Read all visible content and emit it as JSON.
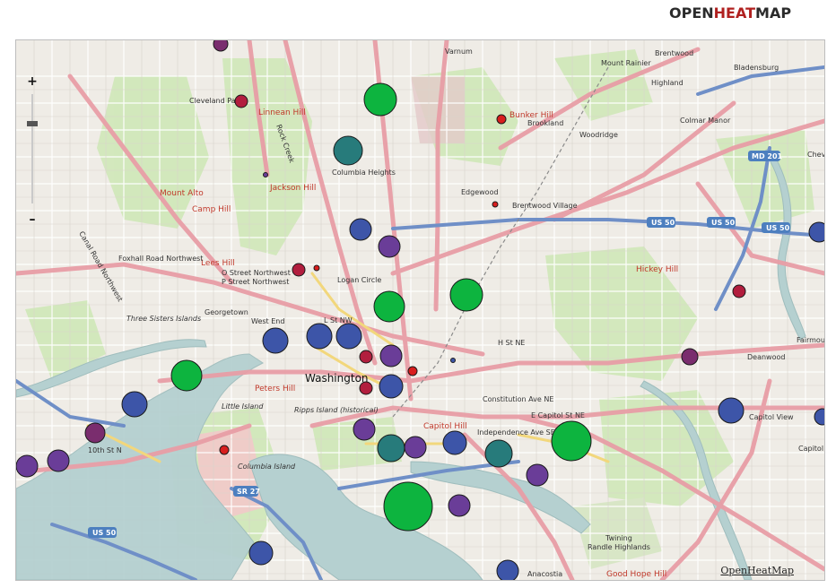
{
  "brand": {
    "part1": "OPEN",
    "part2": "HEAT",
    "part3": "MAP"
  },
  "zoom": {
    "plus": "+",
    "minus": "–"
  },
  "credit": "OpenHeatMap",
  "colors": {
    "green": "#0db43f",
    "teal": "#277b7b",
    "blue": "#3d55a8",
    "purple": "#6a3d98",
    "plum": "#7a2d6e",
    "crimson": "#b21e3e",
    "red": "#d81e1e"
  },
  "labels": [
    "Varnum",
    "Mount Rainier",
    "Brentwood",
    "Highland",
    "Bladensburg",
    "Cleveland Park",
    "Linnean Hill",
    "Bunker Hill",
    "Brookland",
    "Colmar Manor",
    "Columbia Heights",
    "Woodridge",
    "Mount Alto",
    "Jackson Hill",
    "Edgewood",
    "Brentwood Village",
    "Camp Hill",
    "Lees Hill",
    "Foxhall Road Northwest",
    "O Street Northwest",
    "P Street Northwest",
    "Logan Circle",
    "Hickey Hill",
    "Georgetown",
    "Three Sisters Islands",
    "West End",
    "L St NW",
    "Washington",
    "Peters Hill",
    "Little Island",
    "Ripps Island (historical)",
    "Capitol Hill",
    "Columbia Island",
    "Independence Ave SE",
    "Constitution Ave NE",
    "E Capitol St NE",
    "H St NE",
    "Deanwood",
    "Fairmount",
    "Capitol View",
    "Capitol Heights",
    "Twining",
    "Randle Highlands",
    "Anacostia",
    "Good Hope Hill",
    "Chev",
    "10th St N",
    "Canal Road Northwest",
    "Rock Creek"
  ],
  "shields": [
    "MD 201",
    "US 50",
    "US 50",
    "US 50",
    "SR 27",
    "US 50"
  ]
}
